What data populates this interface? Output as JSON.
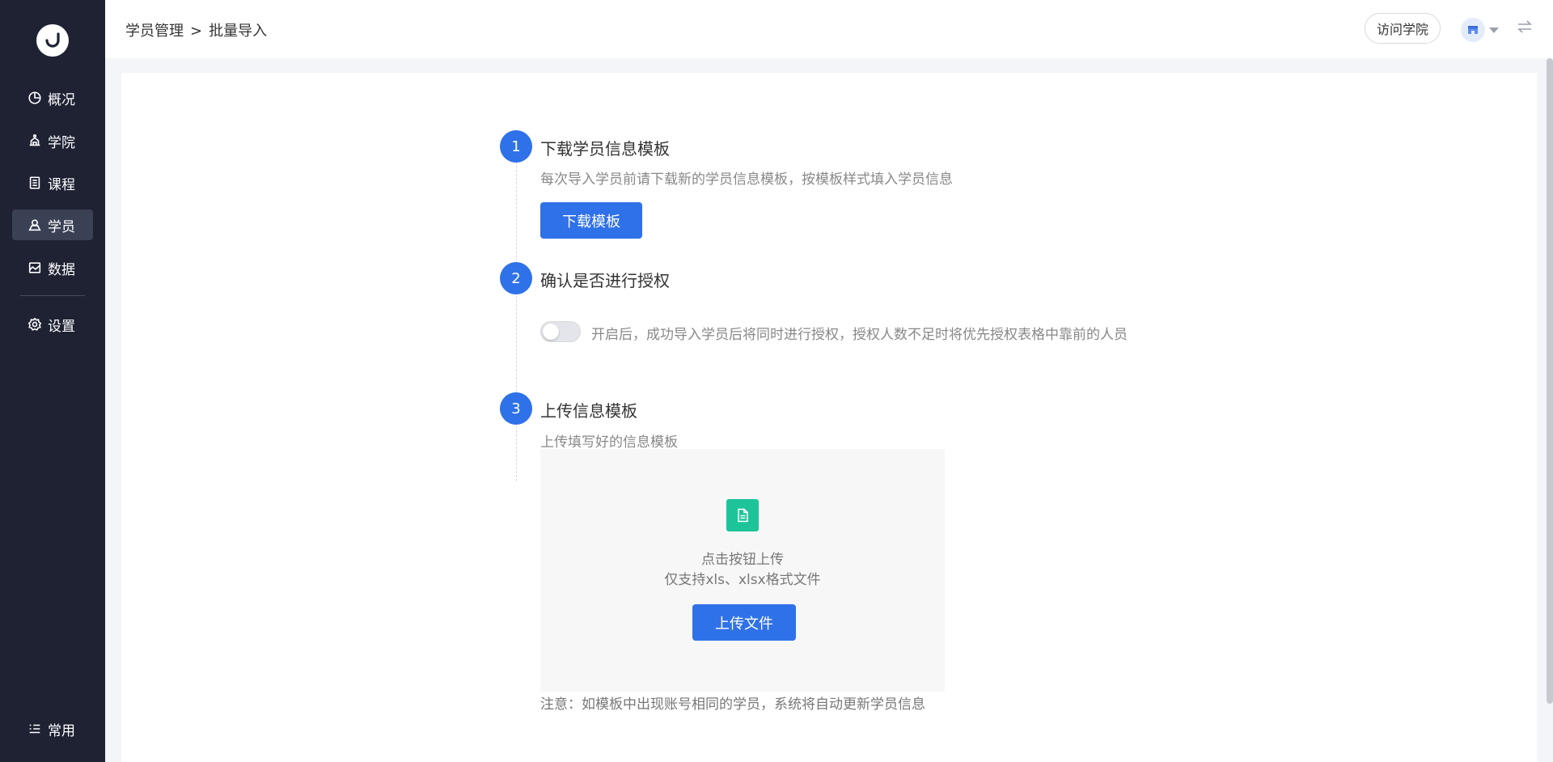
{
  "sidebar": {
    "items": [
      {
        "label": "概况",
        "icon": "pie-chart-icon"
      },
      {
        "label": "学院",
        "icon": "academy-icon"
      },
      {
        "label": "课程",
        "icon": "course-icon"
      },
      {
        "label": "学员",
        "icon": "student-icon",
        "active": true
      },
      {
        "label": "数据",
        "icon": "data-icon"
      },
      {
        "label": "设置",
        "icon": "gear-icon"
      }
    ],
    "bottom_item": {
      "label": "常用",
      "icon": "list-icon"
    }
  },
  "header": {
    "breadcrumb": {
      "parent": "学员管理",
      "separator": ">",
      "current": "批量导入"
    },
    "visit_button": "访问学院"
  },
  "steps": [
    {
      "number": "1",
      "title": "下载学员信息模板",
      "desc": "每次导入学员前请下载新的学员信息模板，按模板样式填入学员信息",
      "button": "下载模板"
    },
    {
      "number": "2",
      "title": "确认是否进行授权",
      "toggle_on": false,
      "toggle_text": "开启后，成功导入学员后将同时进行授权，授权人数不足时将优先授权表格中靠前的人员"
    },
    {
      "number": "3",
      "title": "上传信息模板",
      "desc": "上传填写好的信息模板"
    }
  ],
  "upload": {
    "line1": "点击按钮上传",
    "line2": "仅支持xls、xlsx格式文件",
    "button": "上传文件",
    "note": "注意：如模板中出现账号相同的学员，系统将自动更新学员信息"
  },
  "colors": {
    "primary": "#2f71e8",
    "sidebar_bg": "#1e2233",
    "file_icon": "#1dc499"
  }
}
